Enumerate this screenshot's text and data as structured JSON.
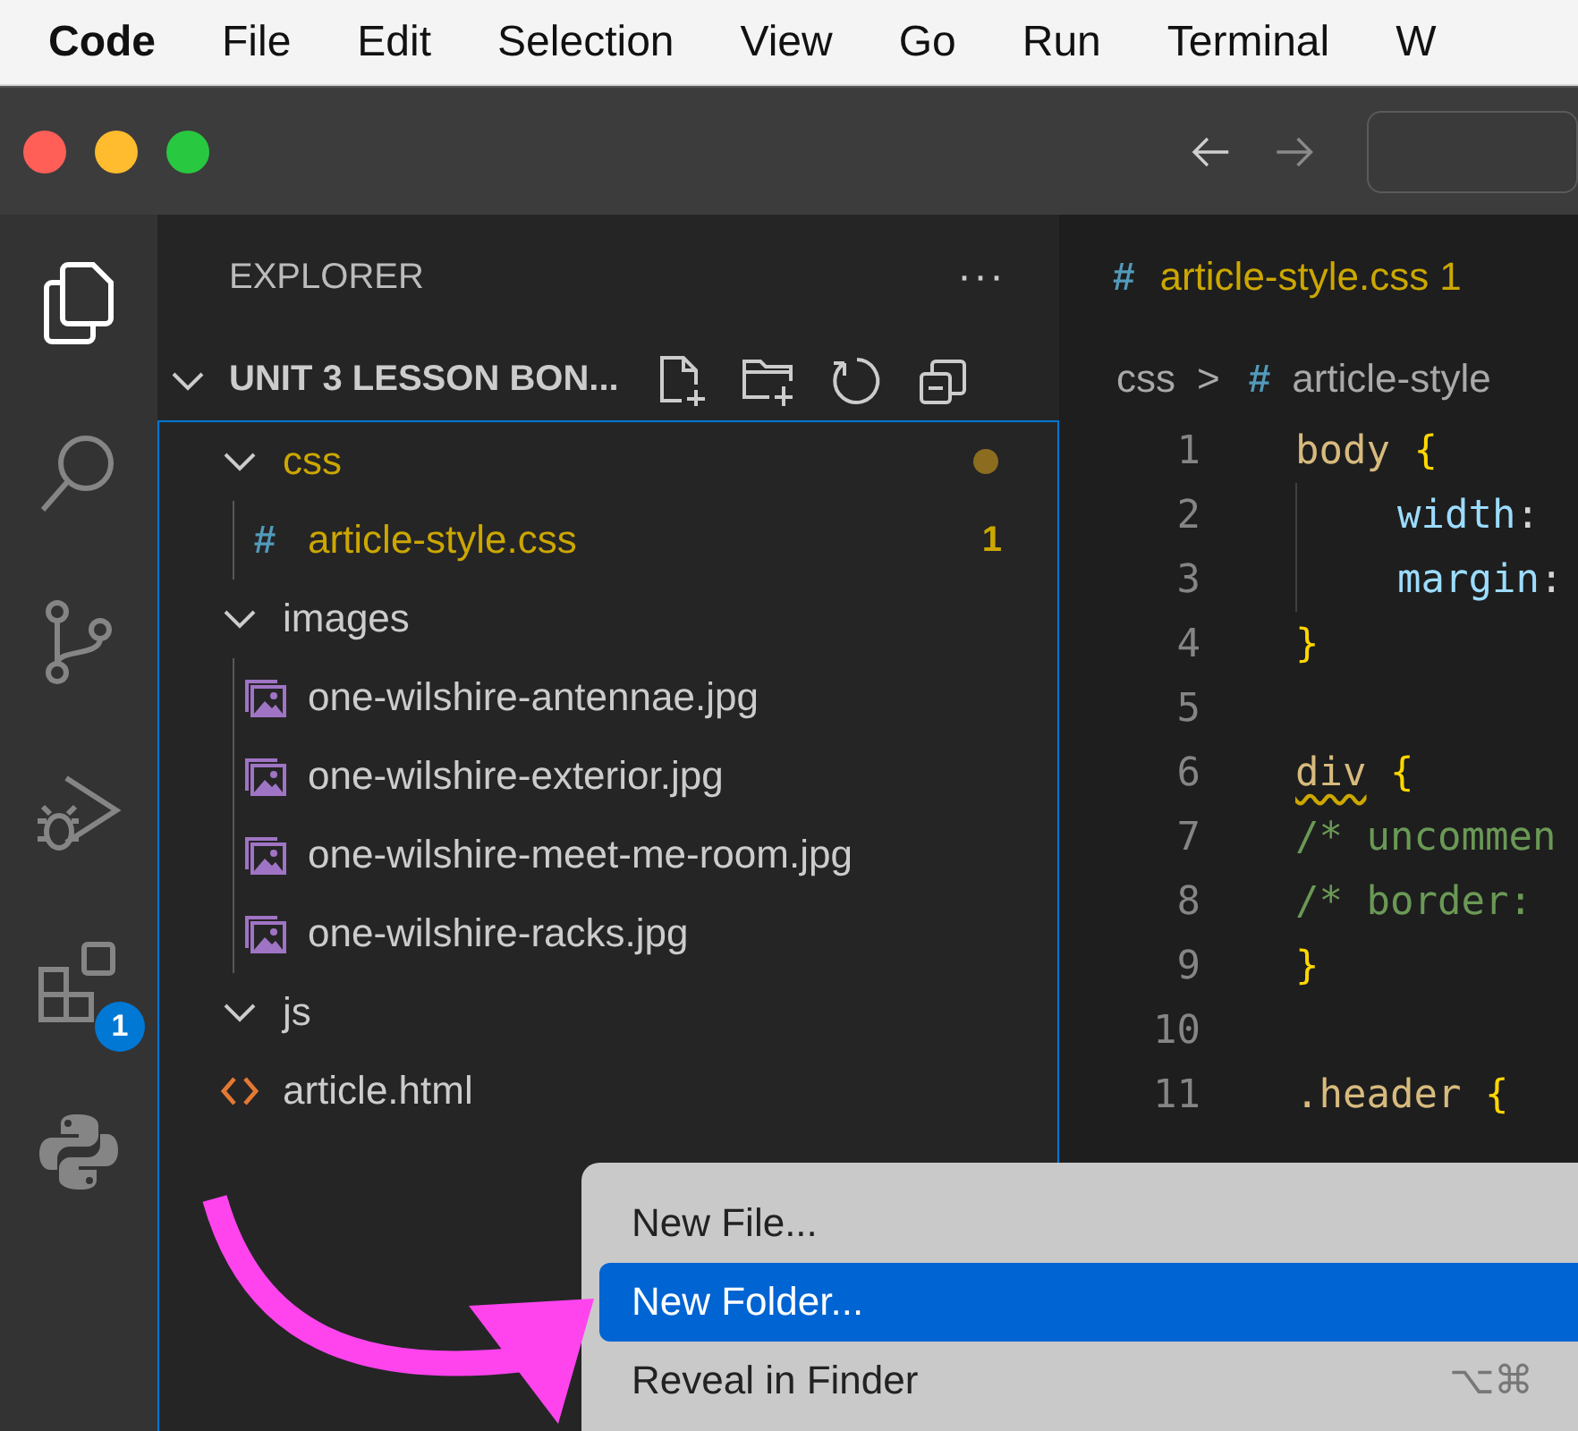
{
  "menu_bar": {
    "app_name": "Code",
    "items": [
      "File",
      "Edit",
      "Selection",
      "View",
      "Go",
      "Run",
      "Terminal",
      "W"
    ]
  },
  "activity_bar": {
    "items": [
      {
        "kind": "explorer",
        "selected": true
      },
      {
        "kind": "search",
        "selected": false
      },
      {
        "kind": "source-control",
        "selected": false
      },
      {
        "kind": "run-debug",
        "selected": false
      },
      {
        "kind": "extensions",
        "selected": false,
        "badge": "1"
      },
      {
        "kind": "python",
        "selected": false
      }
    ]
  },
  "sidebar": {
    "title": "EXPLORER",
    "more": "···",
    "section": {
      "title": "UNIT 3 LESSON BON...",
      "expanded": true
    },
    "tree": [
      {
        "kind": "folder",
        "name": "css",
        "expanded": true,
        "warning": true,
        "children": [
          {
            "kind": "css",
            "name": "article-style.css",
            "warning": true,
            "badge": "1"
          }
        ]
      },
      {
        "kind": "folder",
        "name": "images",
        "expanded": true,
        "warning": false,
        "children": [
          {
            "kind": "image",
            "name": "one-wilshire-antennae.jpg",
            "warning": false
          },
          {
            "kind": "image",
            "name": "one-wilshire-exterior.jpg",
            "warning": false
          },
          {
            "kind": "image",
            "name": "one-wilshire-meet-me-room.jpg",
            "warning": false
          },
          {
            "kind": "image",
            "name": "one-wilshire-racks.jpg",
            "warning": false
          }
        ]
      },
      {
        "kind": "folder",
        "name": "js",
        "expanded": true,
        "warning": false
      },
      {
        "kind": "html",
        "name": "article.html",
        "warning": false
      }
    ]
  },
  "editor": {
    "tab": {
      "icon": "#",
      "name": "article-style.css",
      "badge": "1",
      "selected": true
    },
    "breadcrumb": {
      "folder": "css",
      "separator": ">",
      "icon": "#",
      "file": "article-style"
    },
    "lines": [
      {
        "number": "1",
        "indented": false,
        "tokens": [
          {
            "kind": "selector",
            "text": "body "
          },
          {
            "kind": "brace",
            "text": "{"
          }
        ]
      },
      {
        "number": "2",
        "indented": true,
        "tokens": [
          {
            "kind": "property",
            "text": "width"
          },
          {
            "kind": "plain",
            "text": ":"
          }
        ]
      },
      {
        "number": "3",
        "indented": true,
        "tokens": [
          {
            "kind": "property",
            "text": "margin"
          },
          {
            "kind": "plain",
            "text": ":"
          }
        ]
      },
      {
        "number": "4",
        "indented": false,
        "tokens": [
          {
            "kind": "brace",
            "text": "}"
          }
        ]
      },
      {
        "number": "5",
        "indented": false
      },
      {
        "number": "6",
        "indented": false,
        "tokens": [
          {
            "kind": "selector",
            "text": "div",
            "squiggle": true
          },
          {
            "kind": "brace",
            "text": " {"
          }
        ]
      },
      {
        "number": "7",
        "indented": false,
        "tokens": [
          {
            "kind": "comment",
            "text": "/* uncommen"
          }
        ]
      },
      {
        "number": "8",
        "indented": false,
        "tokens": [
          {
            "kind": "comment",
            "text": "/* border:"
          }
        ]
      },
      {
        "number": "9",
        "indented": false,
        "tokens": [
          {
            "kind": "brace",
            "text": "}"
          }
        ]
      },
      {
        "number": "10",
        "indented": false
      },
      {
        "number": "11",
        "indented": false,
        "tokens": [
          {
            "kind": "selector",
            "text": ".header "
          },
          {
            "kind": "brace",
            "text": "{"
          }
        ]
      }
    ]
  },
  "context_menu": {
    "items": [
      {
        "label": "New File...",
        "selected": false
      },
      {
        "label": "New Folder...",
        "selected": true
      },
      {
        "label": "Reveal in Finder",
        "selected": false,
        "shortcut": "⌥⌘"
      }
    ]
  }
}
